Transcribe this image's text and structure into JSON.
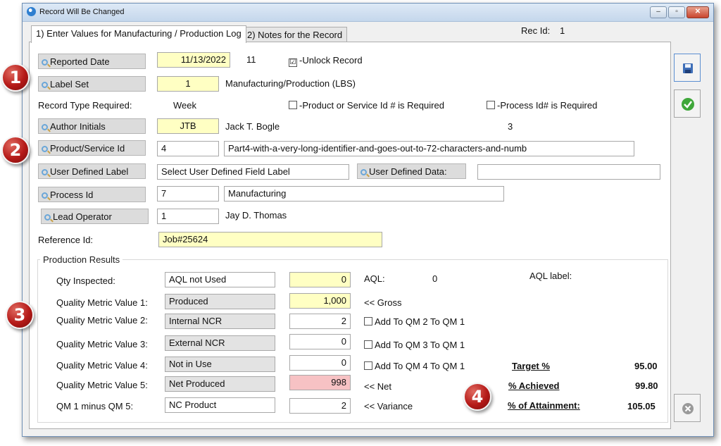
{
  "window": {
    "title": "Record Will Be Changed",
    "minimize": "–",
    "maximize": "▫",
    "close": "✕"
  },
  "tabs": [
    {
      "label": "1) Enter Values for Manufacturing / Production Log"
    },
    {
      "label": "2) Notes for the Record"
    }
  ],
  "rec_id": {
    "label": "Rec Id:",
    "value": "1"
  },
  "form": {
    "reported_date": {
      "button": "Reported Date",
      "value": "11/13/2022",
      "extra": "11",
      "unlock_label": "-Unlock Record",
      "unlock_checked": "☑"
    },
    "label_set": {
      "button": "Label Set",
      "value": "1",
      "description": "Manufacturing/Production (LBS)"
    },
    "record_type": {
      "label": "Record Type Required:",
      "value": "Week",
      "product_required": "-Product or Service Id # is Required",
      "process_required": "-Process Id# is Required"
    },
    "author": {
      "button": "Author Initials",
      "value": "JTB",
      "name": "Jack T. Bogle",
      "count": "3"
    },
    "product": {
      "button": "Product/Service Id",
      "value": "4",
      "description": "Part4-with-a-very-long-identifier-and-goes-out-to-72-characters-and-numb"
    },
    "user_defined": {
      "button": "User Defined Label",
      "value": "Select User Defined Field Label",
      "data_button": "User Defined Data:",
      "data_value": ""
    },
    "process": {
      "button": "Process Id",
      "value": "7",
      "description": "Manufacturing"
    },
    "lead_operator": {
      "button": "Lead Operator",
      "value": "1",
      "name": "Jay D. Thomas"
    },
    "reference": {
      "label": "Reference Id:",
      "value": "Job#25624"
    }
  },
  "production": {
    "title": "Production Results",
    "rows": [
      {
        "label": "Qty Inspected:",
        "name": "AQL not Used",
        "value": "0",
        "note": "AQL:"
      },
      {
        "label": "Quality Metric Value 1:",
        "name": "Produced",
        "value": "1,000",
        "note": "<< Gross"
      },
      {
        "label": "Quality Metric Value 2:",
        "name": "Internal NCR",
        "value": "2",
        "note": "Add To QM 2 To QM 1"
      },
      {
        "label": "Quality Metric Value 3:",
        "name": "External NCR",
        "value": "0",
        "note": "Add To QM 3 To QM 1"
      },
      {
        "label": "Quality Metric Value 4:",
        "name": "Not in Use",
        "value": "0",
        "note": "Add To QM 4 To QM 1"
      },
      {
        "label": "Quality Metric Value 5:",
        "name": "Net Produced",
        "value": "998",
        "note": "<< Net"
      },
      {
        "label": "QM 1 minus QM 5:",
        "name": "NC Product",
        "value": "2",
        "note": "<< Variance"
      }
    ],
    "aql_value": "0",
    "aql_label": "AQL label:",
    "target": {
      "label": "Target %",
      "value": "95.00"
    },
    "achieved": {
      "label": "% Achieved",
      "value": "99.80"
    },
    "attainment": {
      "label": "% of Attainment:",
      "value": "105.05"
    }
  },
  "callouts": [
    "1",
    "2",
    "3",
    "4"
  ],
  "icons": {
    "save": "save-icon",
    "ok": "checkmark-icon",
    "cancel": "close-icon"
  },
  "colors": {
    "required_field": "#ffffc3",
    "alert_field": "#f7c2c4",
    "callout": "#b51a18"
  }
}
